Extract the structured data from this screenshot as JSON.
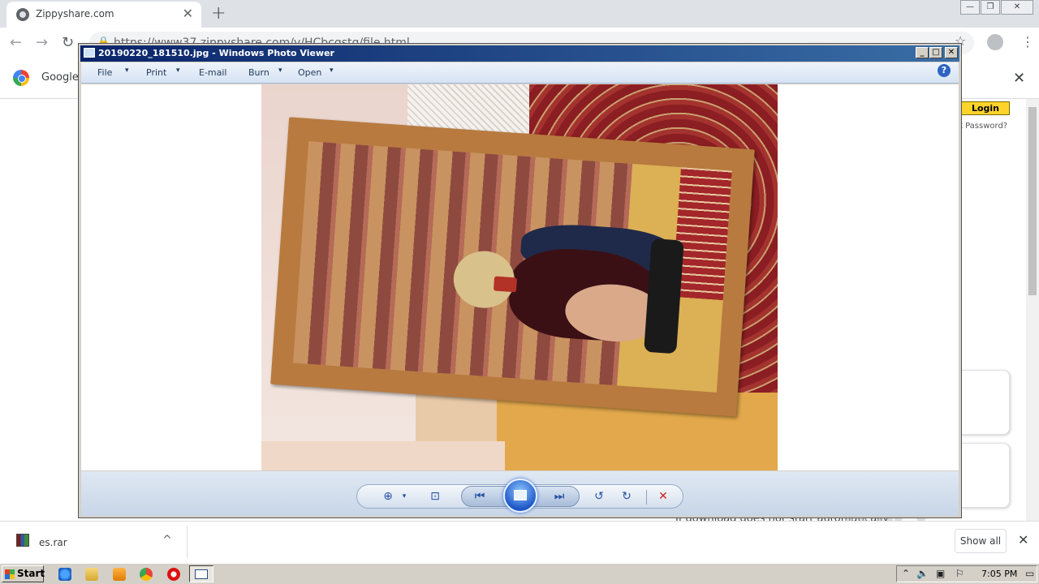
{
  "browser": {
    "tab_title": "Zippyshare.com",
    "tab_close": "✕",
    "new_tab": "+",
    "address": "https://www37.zippyshare.com/v/HCbcqstq/file.html",
    "bookmark_label": "Google C",
    "infobar_close": "✕",
    "window_controls": [
      "—",
      "❐",
      "✕"
    ]
  },
  "page": {
    "login_button": "Login",
    "forgot_link": "t Password?",
    "footnote": "If download does not start automatically",
    "watermark": "ANY RUN"
  },
  "downloads": {
    "file_name": "es.rar",
    "chevron": "^",
    "show_all": "Show all",
    "close": "✕"
  },
  "photo_viewer": {
    "title": "20190220_181510.jpg - Windows Photo Viewer",
    "window_controls": [
      "_",
      "□",
      "✕"
    ],
    "menu": [
      {
        "label": "File",
        "has_dropdown": true
      },
      {
        "label": "Print",
        "has_dropdown": true
      },
      {
        "label": "E-mail",
        "has_dropdown": false
      },
      {
        "label": "Burn",
        "has_dropdown": true
      },
      {
        "label": "Open",
        "has_dropdown": true
      }
    ],
    "help": "?",
    "controls": {
      "zoom": "⊕",
      "actual_size": "⊡",
      "previous": "⏮",
      "next": "⏭",
      "rotate_ccw": "↺",
      "rotate_cw": "↻",
      "delete": "✕",
      "caret": "▾"
    }
  },
  "taskbar": {
    "start_label": "Start",
    "clock": "7:05 PM",
    "tray_icons": [
      "up-arrow-icon",
      "speaker-icon",
      "network-icon",
      "flag-icon",
      "desktop-icon"
    ]
  },
  "colors": {
    "titlebar_start": "#0a246a",
    "titlebar_end": "#3a6ea5",
    "zippy_yellow": "#ffd42a",
    "delete_red": "#d0231f"
  }
}
